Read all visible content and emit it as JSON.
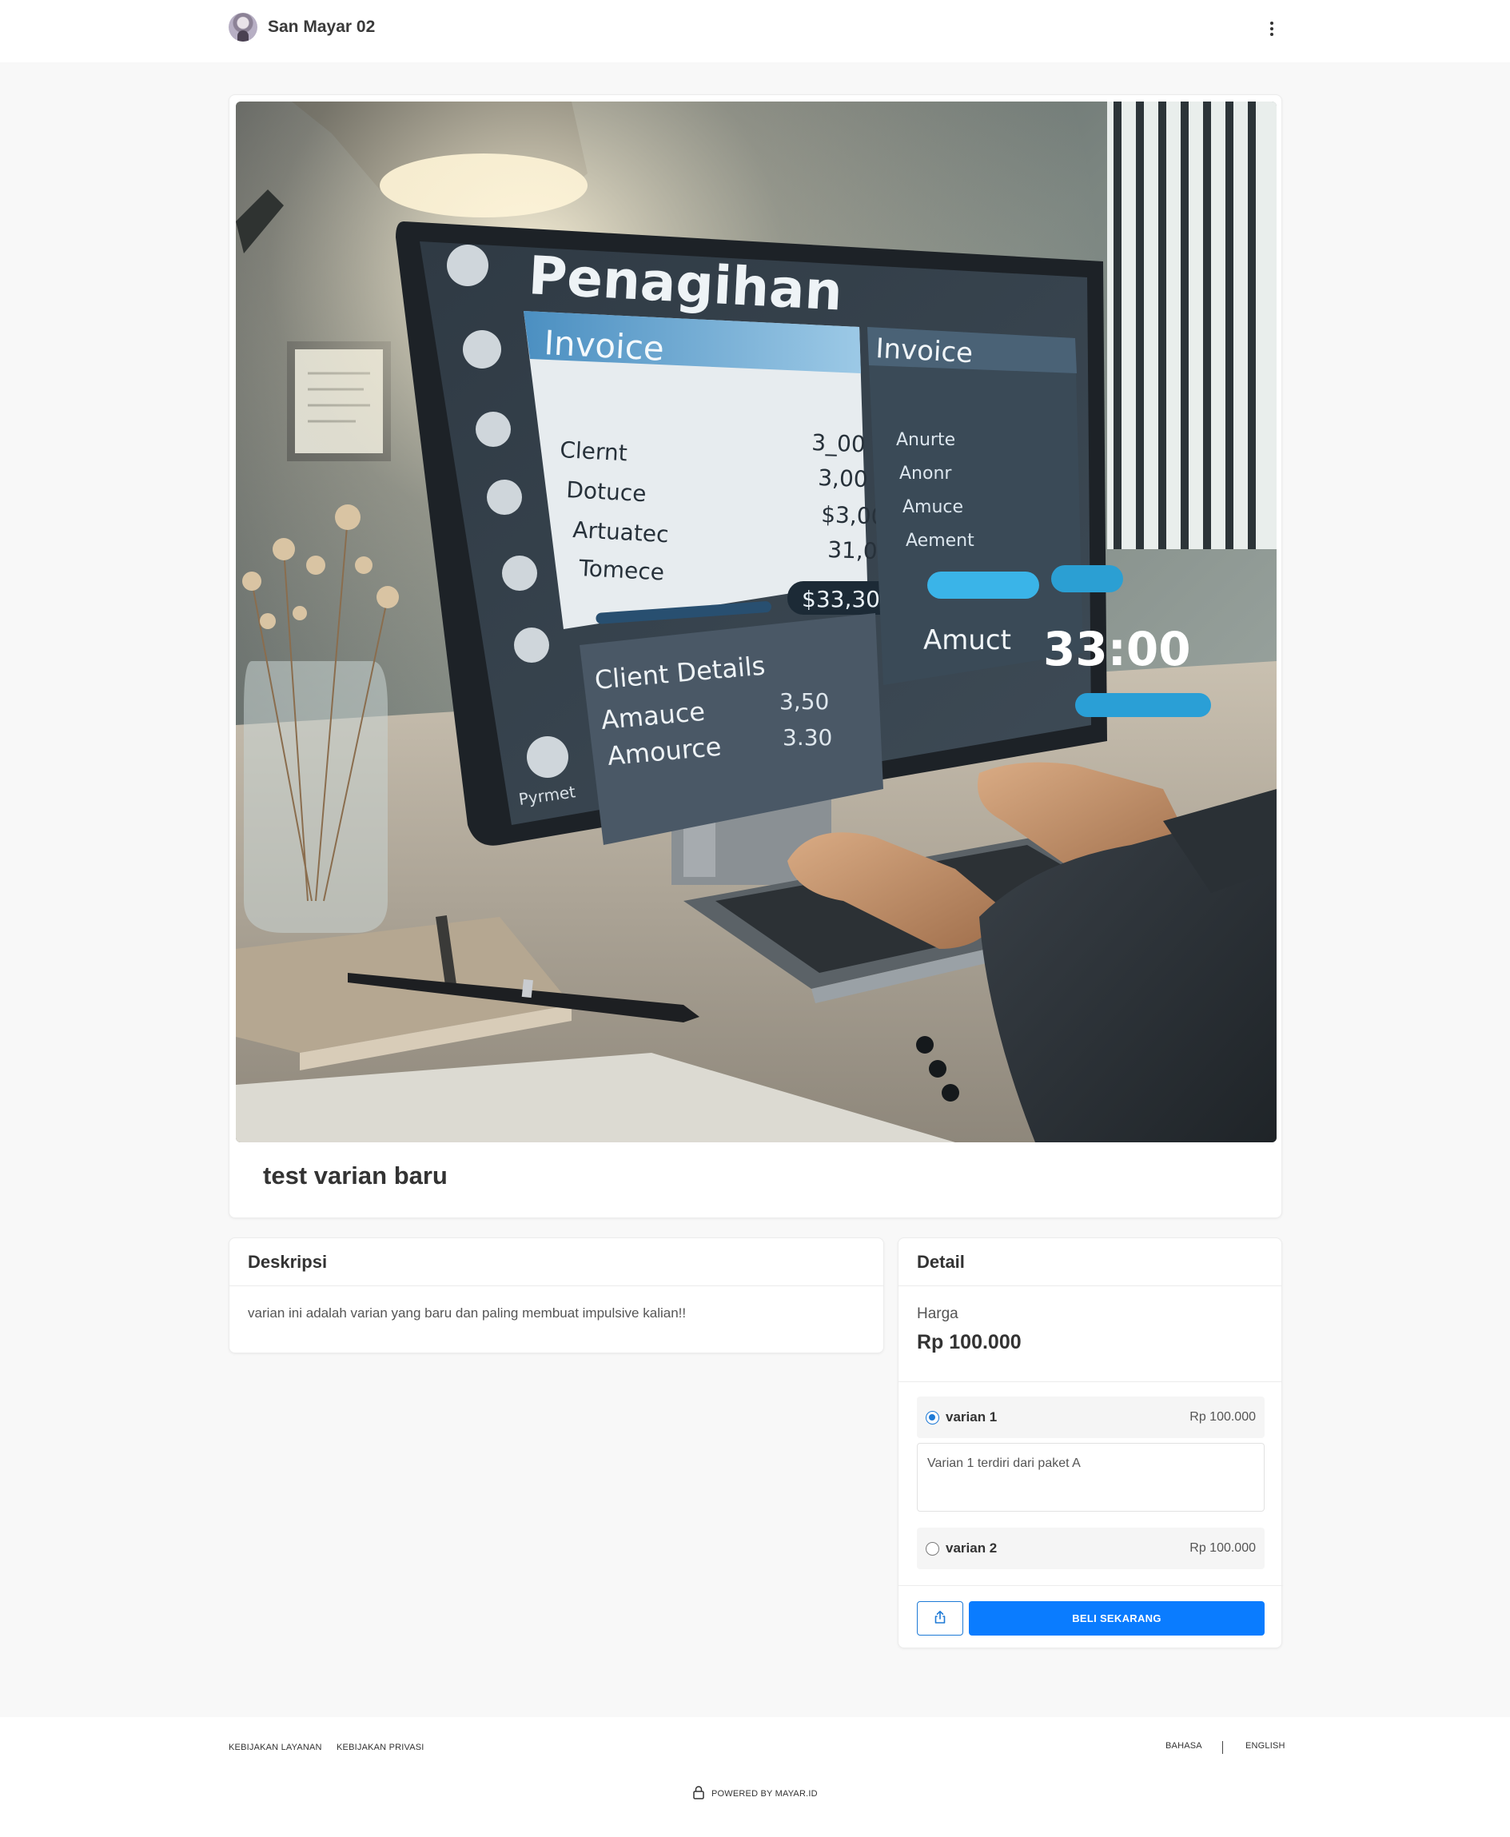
{
  "header": {
    "store_name": "San Mayar 02"
  },
  "product": {
    "title": "test varian baru",
    "image": {
      "heading": "Penagihan",
      "panel_title": "Invoice",
      "panel_title_2": "Invoice",
      "rows": [
        {
          "label": "Clernt",
          "value": "3_00"
        },
        {
          "label": "Dotuce",
          "value": "3,00"
        },
        {
          "label": "Artuatec",
          "value": "$3,00"
        },
        {
          "label": "Tomece",
          "value": "31,00"
        }
      ],
      "total": "$33,30",
      "right_rows": [
        "Anurte",
        "Anonr",
        "Amuce",
        "Aement"
      ],
      "big_amount_label": "Amuct",
      "big_amount": "33:00",
      "client_details": "Client Details",
      "client_rows": [
        {
          "label": "Amauce",
          "value": "3,50"
        },
        {
          "label": "Amource",
          "value": "3.30"
        }
      ],
      "sidebar_label": "Pyrmet"
    }
  },
  "description": {
    "heading": "Deskripsi",
    "text": "varian ini adalah varian yang baru dan paling membuat impulsive kalian!!"
  },
  "detail": {
    "heading": "Detail",
    "price_label": "Harga",
    "price_value": "Rp 100.000",
    "variants": [
      {
        "name": "varian 1",
        "price": "Rp 100.000",
        "selected": true,
        "description": "Varian 1 terdiri dari paket A"
      },
      {
        "name": "varian 2",
        "price": "Rp 100.000",
        "selected": false
      }
    ],
    "buy_label": "BELI SEKARANG",
    "share_icon": "share-icon",
    "accent_color": "#0a7cff"
  },
  "footer": {
    "terms": "KEBIJAKAN LAYANAN",
    "privacy": "KEBIJAKAN PRIVASI",
    "language_label": "BAHASA",
    "language_value": "ENGLISH",
    "powered_by": "POWERED BY MAYAR.ID"
  }
}
